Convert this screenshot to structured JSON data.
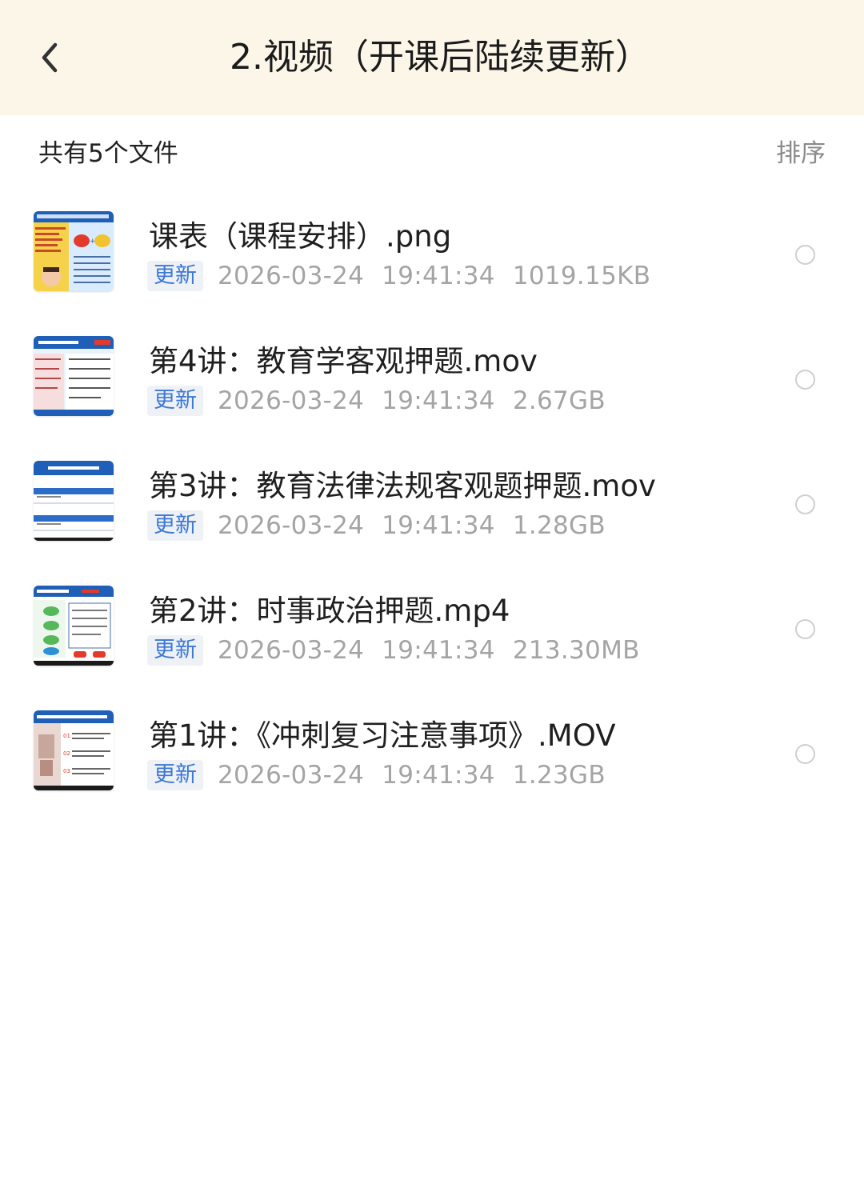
{
  "header": {
    "title": "2.视频（开课后陆续更新）",
    "back_icon": "chevron-left-icon"
  },
  "toolbar": {
    "file_count_label": "共有5个文件",
    "sort_label": "排序"
  },
  "files": [
    {
      "name": "课表（课程安排）.png",
      "badge": "更新",
      "date": "2026-03-24",
      "time": "19:41:34",
      "size": "1019.15KB",
      "thumbnail": "schedule-image-thumbnail"
    },
    {
      "name": "第4讲：教育学客观押题.mov",
      "badge": "更新",
      "date": "2026-03-24",
      "time": "19:41:34",
      "size": "2.67GB",
      "thumbnail": "video-slide-thumbnail"
    },
    {
      "name": "第3讲：教育法律法规客观题押题.mov",
      "badge": "更新",
      "date": "2026-03-24",
      "time": "19:41:34",
      "size": "1.28GB",
      "thumbnail": "video-slide-thumbnail"
    },
    {
      "name": "第2讲：时事政治押题.mp4",
      "badge": "更新",
      "date": "2026-03-24",
      "time": "19:41:34",
      "size": "213.30MB",
      "thumbnail": "video-slide-thumbnail"
    },
    {
      "name": "第1讲：《冲刺复习注意事项》.MOV",
      "badge": "更新",
      "date": "2026-03-24",
      "time": "19:41:34",
      "size": "1.23GB",
      "thumbnail": "video-slide-thumbnail"
    }
  ],
  "colors": {
    "header_bg": "#fbf6e8",
    "badge_text": "#3d78d8",
    "badge_bg": "#eef1f6",
    "meta_text": "#a4a4a4",
    "thumb_blue": "#1f5fb8"
  }
}
